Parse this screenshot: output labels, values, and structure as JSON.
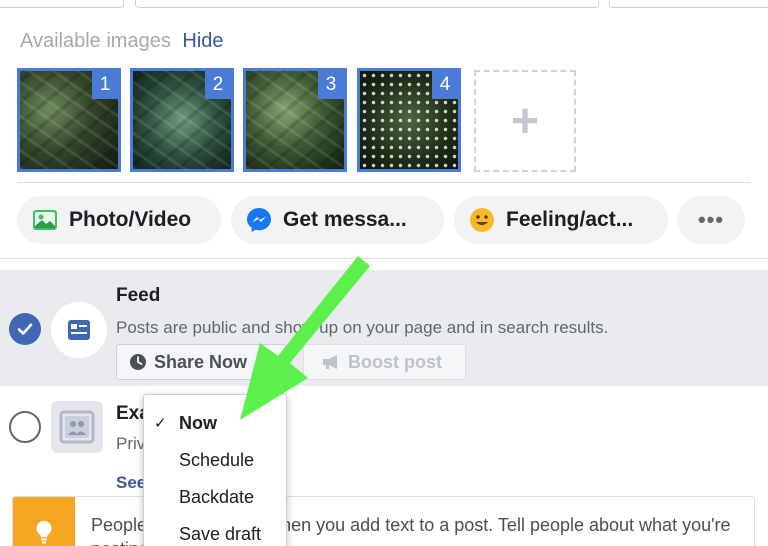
{
  "images": {
    "label": "Available images",
    "hide_link": "Hide",
    "thumbnails": [
      {
        "number": "1"
      },
      {
        "number": "2"
      },
      {
        "number": "3"
      },
      {
        "number": "4"
      }
    ],
    "add_symbol": "+"
  },
  "actions": {
    "photo_video": "Photo/Video",
    "get_messages": "Get messa...",
    "feeling": "Feeling/act...",
    "more": "•••"
  },
  "feed": {
    "title": "Feed",
    "description": "Posts are public and show up on your page and in search results.",
    "share_now": "Share Now",
    "boost_post": "Boost post",
    "selected": true
  },
  "exclusive": {
    "title": "Exa",
    "description": "Priv",
    "see_more": "See"
  },
  "tip": {
    "text": "People respond more when you add text to a post. Tell people about what you're posting."
  },
  "dropdown": {
    "items": [
      {
        "label": "Now",
        "selected": true,
        "check": "✓"
      },
      {
        "label": "Schedule",
        "selected": false
      },
      {
        "label": "Backdate",
        "selected": false
      },
      {
        "label": "Save draft",
        "selected": false
      }
    ]
  },
  "colors": {
    "accent_blue": "#4267b2",
    "link_blue": "#385898",
    "tip_orange": "#f5a623",
    "arrow_green": "#5cf04a"
  }
}
